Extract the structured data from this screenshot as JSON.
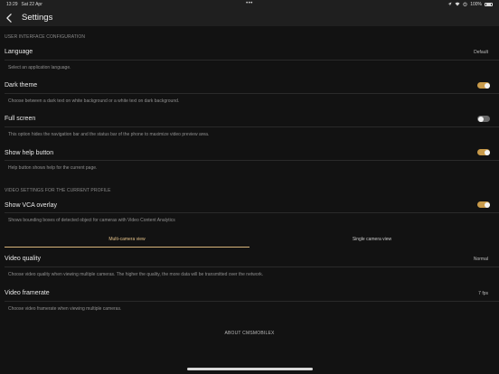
{
  "status": {
    "time": "13:29",
    "date": "Sat 22 Apr",
    "battery": "100%"
  },
  "nav": {
    "title": "Settings"
  },
  "sections": {
    "ui": "USER INTERFACE CONFIGURATION",
    "video": "VIDEO SETTINGS FOR THE CURRENT PROFILE"
  },
  "language": {
    "title": "Language",
    "value": "Default",
    "desc": "Select an application language."
  },
  "dark_theme": {
    "title": "Dark theme",
    "desc": "Choose between a dark text on white background or a white text on dark background.",
    "enabled": true
  },
  "full_screen": {
    "title": "Full screen",
    "desc": "This option hides the navigation bar and the status bar of the phone to maximize video preview area.",
    "enabled": false
  },
  "help_button": {
    "title": "Show help button",
    "desc": "Help button shows help for the current page.",
    "enabled": true
  },
  "vca": {
    "title": "Show VCA overlay",
    "desc": "Shows bounding boxes of detected object for cameras with Video Content Analytics",
    "enabled": true
  },
  "tabs": {
    "multi": "Multi-camera view",
    "single": "Single camera view",
    "active": "multi"
  },
  "video_quality": {
    "title": "Video quality",
    "value": "Normal",
    "desc": "Choose video quality when viewing multiple cameras. The higher the quality, the more data will be transmitted over the network."
  },
  "video_framerate": {
    "title": "Video framerate",
    "value": "7 fps",
    "desc": "Choose video framerate when viewing multiple cameras."
  },
  "about": "ABOUT CMSMOBILEX",
  "colors": {
    "accent": "#c89a4a",
    "background": "#121212",
    "bar": "#1f1f1f"
  }
}
